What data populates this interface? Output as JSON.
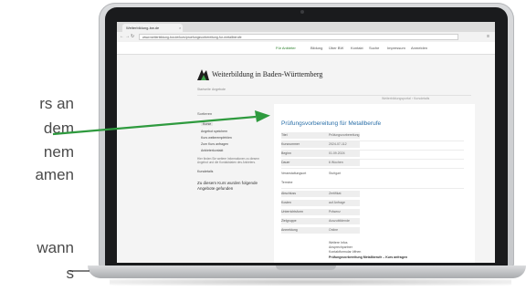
{
  "side_text": [
    "rs an",
    "dem",
    "nem",
    "amen",
    "wann",
    "s"
  ],
  "browser": {
    "tab_title": "Weiterbildung-bw.de",
    "url": "www.weiterbildung-bw.de/kurs/pruefungsvorbereitung-fur-metallberufe"
  },
  "site": {
    "topnav": [
      "Für Anbieter",
      "Bildung",
      "Über BW",
      "Kontakt",
      "Suche",
      "Impressum",
      "Anmelden"
    ],
    "logo_text": "Weiterbildung in Baden-Württemberg",
    "breadcrumbs": [
      "Startseite",
      "Angebote"
    ],
    "breadcrumb_right": "Weiterbildungsportal › Kursdetails",
    "sidebar": {
      "heading": "Sortieren",
      "items": [
        "Kurse",
        "Angebot speichern",
        "Kurs weiterempfehlen",
        "Zum Kurs anfragen",
        "Anbieterkontakt"
      ],
      "note_lines": [
        "Hier finden Sie weitere Informationen zu diesem",
        "Angebot und die Kontaktdaten des Anbieters."
      ],
      "section_title": "Kursdetails",
      "subheading": "Zu diesem Kurs wurden folgende",
      "subheading2": "Angebote gefunden"
    },
    "content": {
      "title": "Prüfungsvorbereitung für Metallberufe",
      "rows": [
        {
          "k": "Titel",
          "v": "Prüfungsvorbereitung"
        },
        {
          "k": "Kursnummer",
          "v": "2024-07-112"
        },
        {
          "k": "Beginn",
          "v": "01.09.2024"
        },
        {
          "k": "Dauer",
          "v": "6 Wochen"
        },
        {
          "k": "Veranstaltungsort",
          "v": "Stuttgart"
        },
        {
          "k": "Termine",
          "v": ""
        },
        {
          "k": "Abschluss",
          "v": "Zertifikat"
        },
        {
          "k": "Kosten",
          "v": "auf Anfrage"
        },
        {
          "k": "Unterrichtsform",
          "v": "Präsenz"
        },
        {
          "k": "Zielgruppe",
          "v": "Auszubildende"
        },
        {
          "k": "Anmeldung",
          "v": "Online"
        }
      ],
      "blurb": [
        "Weitere Infos",
        "Ansprechpartner",
        "Kontaktformular öffnen"
      ],
      "blurb_bold": "Prüfungsvorbereitung Metallberufe – Kurs anfragen"
    }
  },
  "colors": {
    "arrow": "#2e9a3e",
    "title_blue": "#2a6fa8",
    "bezel": "#1a1b1d"
  }
}
